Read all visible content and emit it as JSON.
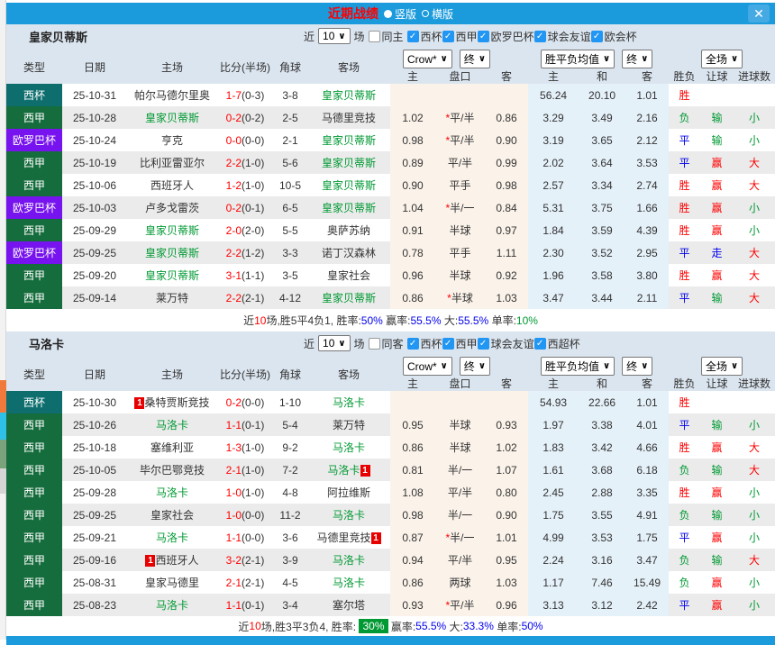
{
  "titlebar": {
    "title": "近期战绩",
    "radio_selected": "竖版",
    "radio_unselected": "横版",
    "close_glyph": "✕"
  },
  "header": {
    "type": "类型",
    "date": "日期",
    "home": "主场",
    "score": "比分(半场)",
    "corner": "角球",
    "away": "客场",
    "crow_select": "Crow*",
    "end_select": "终",
    "crow_subs": [
      "主",
      "盘口",
      "客"
    ],
    "avg_select": "胜平负均值",
    "end_select2": "终",
    "avg_subs": [
      "主",
      "和",
      "客"
    ],
    "result": "胜负",
    "full_select": "全场",
    "handicap": "让球",
    "goals": "进球数",
    "chevron": "∨"
  },
  "colors": {
    "accent_blue": "#1B9BDC",
    "checkbox_blue": "#2196F3",
    "team_green": "#009933",
    "type_colors": {
      "西杯": "#0E6E6E",
      "西甲": "#156C3C",
      "欧罗巴杯": "#7713EE"
    },
    "value_colors": {
      "胜": "#FF0000",
      "平": "#0000EE",
      "负": "#009933",
      "赢": "#FF0000",
      "输": "#009933",
      "走": "#0000EE",
      "大": "#FF0000",
      "小": "#009933"
    },
    "summary_colors": {
      "dark": "#333333",
      "red": "#FF0000",
      "blue": "#0000EE",
      "green": "#009933"
    }
  },
  "sections": [
    {
      "team": "皇家贝蒂斯",
      "filter": {
        "near": "近",
        "count": "10",
        "games": "场",
        "same": "同主",
        "same_checked": false,
        "check_glyph": "✓",
        "comps": [
          "西杯",
          "西甲",
          "欧罗巴杯",
          "球会友谊",
          "欧会杯"
        ]
      },
      "rows": [
        {
          "type": "西杯",
          "date": "25-10-31",
          "home": {
            "name": "帕尔马德尔里奥",
            "green": false
          },
          "score": "1-7",
          "half": "(0-3)",
          "corner": "3-8",
          "away": {
            "name": "皇家贝蒂斯",
            "green": true
          },
          "o1": "",
          "hcap": "",
          "o2": "",
          "a1": "56.24",
          "a2": "20.10",
          "a3": "1.01",
          "res": "胜",
          "wl": "",
          "size": ""
        },
        {
          "type": "西甲",
          "date": "25-10-28",
          "home": {
            "name": "皇家贝蒂斯",
            "green": true
          },
          "score": "0-2",
          "half": "(0-2)",
          "corner": "2-5",
          "away": {
            "name": "马德里竞技",
            "green": false
          },
          "o1": "1.02",
          "hcap": "*平/半",
          "o2": "0.86",
          "a1": "3.29",
          "a2": "3.49",
          "a3": "2.16",
          "res": "负",
          "wl": "输",
          "size": "小"
        },
        {
          "type": "欧罗巴杯",
          "date": "25-10-24",
          "home": {
            "name": "亨克",
            "green": false
          },
          "score": "0-0",
          "half": "(0-0)",
          "corner": "2-1",
          "away": {
            "name": "皇家贝蒂斯",
            "green": true
          },
          "o1": "0.98",
          "hcap": "*平/半",
          "o2": "0.90",
          "a1": "3.19",
          "a2": "3.65",
          "a3": "2.12",
          "res": "平",
          "wl": "输",
          "size": "小"
        },
        {
          "type": "西甲",
          "date": "25-10-19",
          "home": {
            "name": "比利亚雷亚尔",
            "green": false
          },
          "score": "2-2",
          "half": "(1-0)",
          "corner": "5-6",
          "away": {
            "name": "皇家贝蒂斯",
            "green": true
          },
          "o1": "0.89",
          "hcap": "平/半",
          "o2": "0.99",
          "a1": "2.02",
          "a2": "3.64",
          "a3": "3.53",
          "res": "平",
          "wl": "赢",
          "size": "大"
        },
        {
          "type": "西甲",
          "date": "25-10-06",
          "home": {
            "name": "西班牙人",
            "green": false
          },
          "score": "1-2",
          "half": "(1-0)",
          "corner": "10-5",
          "away": {
            "name": "皇家贝蒂斯",
            "green": true
          },
          "o1": "0.90",
          "hcap": "平手",
          "o2": "0.98",
          "a1": "2.57",
          "a2": "3.34",
          "a3": "2.74",
          "res": "胜",
          "wl": "赢",
          "size": "大"
        },
        {
          "type": "欧罗巴杯",
          "date": "25-10-03",
          "home": {
            "name": "卢多戈雷茨",
            "green": false
          },
          "score": "0-2",
          "half": "(0-1)",
          "corner": "6-5",
          "away": {
            "name": "皇家贝蒂斯",
            "green": true
          },
          "o1": "1.04",
          "hcap": "*半/一",
          "o2": "0.84",
          "a1": "5.31",
          "a2": "3.75",
          "a3": "1.66",
          "res": "胜",
          "wl": "赢",
          "size": "小"
        },
        {
          "type": "西甲",
          "date": "25-09-29",
          "home": {
            "name": "皇家贝蒂斯",
            "green": true
          },
          "score": "2-0",
          "half": "(2-0)",
          "corner": "5-5",
          "away": {
            "name": "奥萨苏纳",
            "green": false
          },
          "o1": "0.91",
          "hcap": "半球",
          "o2": "0.97",
          "a1": "1.84",
          "a2": "3.59",
          "a3": "4.39",
          "res": "胜",
          "wl": "赢",
          "size": "小"
        },
        {
          "type": "欧罗巴杯",
          "date": "25-09-25",
          "home": {
            "name": "皇家贝蒂斯",
            "green": true
          },
          "score": "2-2",
          "half": "(1-2)",
          "corner": "3-3",
          "away": {
            "name": "诺丁汉森林",
            "green": false
          },
          "o1": "0.78",
          "hcap": "平手",
          "o2": "1.11",
          "a1": "2.30",
          "a2": "3.52",
          "a3": "2.95",
          "res": "平",
          "wl": "走",
          "size": "大"
        },
        {
          "type": "西甲",
          "date": "25-09-20",
          "home": {
            "name": "皇家贝蒂斯",
            "green": true
          },
          "score": "3-1",
          "half": "(1-1)",
          "corner": "3-5",
          "away": {
            "name": "皇家社会",
            "green": false
          },
          "o1": "0.96",
          "hcap": "半球",
          "o2": "0.92",
          "a1": "1.96",
          "a2": "3.58",
          "a3": "3.80",
          "res": "胜",
          "wl": "赢",
          "size": "大"
        },
        {
          "type": "西甲",
          "date": "25-09-14",
          "home": {
            "name": "莱万特",
            "green": false
          },
          "score": "2-2",
          "half": "(2-1)",
          "corner": "4-12",
          "away": {
            "name": "皇家贝蒂斯",
            "green": true
          },
          "o1": "0.86",
          "hcap": "*半球",
          "o2": "1.03",
          "a1": "3.47",
          "a2": "3.44",
          "a3": "2.11",
          "res": "平",
          "wl": "输",
          "size": "大"
        }
      ],
      "summary": [
        {
          "text": "近",
          "color": "dark"
        },
        {
          "text": "10",
          "color": "red"
        },
        {
          "text": "场,胜5平4负1, 胜率:",
          "color": "dark"
        },
        {
          "text": "50%",
          "color": "blue"
        },
        {
          "text": " 赢率:",
          "color": "dark"
        },
        {
          "text": "55.5%",
          "color": "blue"
        },
        {
          "text": " 大:",
          "color": "dark"
        },
        {
          "text": "55.5%",
          "color": "blue"
        },
        {
          "text": " 单率:",
          "color": "dark"
        },
        {
          "text": "10%",
          "color": "green"
        }
      ]
    },
    {
      "team": "马洛卡",
      "filter": {
        "near": "近",
        "count": "10",
        "games": "场",
        "same": "同客",
        "same_checked": false,
        "check_glyph": "✓",
        "comps": [
          "西杯",
          "西甲",
          "球会友谊",
          "西超杯"
        ]
      },
      "rows": [
        {
          "type": "西杯",
          "date": "25-10-30",
          "home": {
            "name": "桑特贾斯竞技",
            "green": false,
            "badge": "1",
            "badge_pos": "before"
          },
          "score": "0-2",
          "half": "(0-0)",
          "corner": "1-10",
          "away": {
            "name": "马洛卡",
            "green": true
          },
          "o1": "",
          "hcap": "",
          "o2": "",
          "a1": "54.93",
          "a2": "22.66",
          "a3": "1.01",
          "res": "胜",
          "wl": "",
          "size": ""
        },
        {
          "type": "西甲",
          "date": "25-10-26",
          "home": {
            "name": "马洛卡",
            "green": true
          },
          "score": "1-1",
          "half": "(0-1)",
          "corner": "5-4",
          "away": {
            "name": "莱万特",
            "green": false
          },
          "o1": "0.95",
          "hcap": "半球",
          "o2": "0.93",
          "a1": "1.97",
          "a2": "3.38",
          "a3": "4.01",
          "res": "平",
          "wl": "输",
          "size": "小"
        },
        {
          "type": "西甲",
          "date": "25-10-18",
          "home": {
            "name": "塞维利亚",
            "green": false
          },
          "score": "1-3",
          "half": "(1-0)",
          "corner": "9-2",
          "away": {
            "name": "马洛卡",
            "green": true
          },
          "o1": "0.86",
          "hcap": "半球",
          "o2": "1.02",
          "a1": "1.83",
          "a2": "3.42",
          "a3": "4.66",
          "res": "胜",
          "wl": "赢",
          "size": "大"
        },
        {
          "type": "西甲",
          "date": "25-10-05",
          "home": {
            "name": "毕尔巴鄂竞技",
            "green": false
          },
          "score": "2-1",
          "half": "(1-0)",
          "corner": "7-2",
          "away": {
            "name": "马洛卡",
            "green": true,
            "badge": "1",
            "badge_pos": "after"
          },
          "o1": "0.81",
          "hcap": "半/一",
          "o2": "1.07",
          "a1": "1.61",
          "a2": "3.68",
          "a3": "6.18",
          "res": "负",
          "wl": "输",
          "size": "大"
        },
        {
          "type": "西甲",
          "date": "25-09-28",
          "home": {
            "name": "马洛卡",
            "green": true
          },
          "score": "1-0",
          "half": "(1-0)",
          "corner": "4-8",
          "away": {
            "name": "阿拉维斯",
            "green": false
          },
          "o1": "1.08",
          "hcap": "平/半",
          "o2": "0.80",
          "a1": "2.45",
          "a2": "2.88",
          "a3": "3.35",
          "res": "胜",
          "wl": "赢",
          "size": "小"
        },
        {
          "type": "西甲",
          "date": "25-09-25",
          "home": {
            "name": "皇家社会",
            "green": false
          },
          "score": "1-0",
          "half": "(0-0)",
          "corner": "11-2",
          "away": {
            "name": "马洛卡",
            "green": true
          },
          "o1": "0.98",
          "hcap": "半/一",
          "o2": "0.90",
          "a1": "1.75",
          "a2": "3.55",
          "a3": "4.91",
          "res": "负",
          "wl": "输",
          "size": "小"
        },
        {
          "type": "西甲",
          "date": "25-09-21",
          "home": {
            "name": "马洛卡",
            "green": true
          },
          "score": "1-1",
          "half": "(0-0)",
          "corner": "3-6",
          "away": {
            "name": "马德里竞技",
            "green": false,
            "badge": "1",
            "badge_pos": "after"
          },
          "o1": "0.87",
          "hcap": "*半/一",
          "o2": "1.01",
          "a1": "4.99",
          "a2": "3.53",
          "a3": "1.75",
          "res": "平",
          "wl": "赢",
          "size": "小"
        },
        {
          "type": "西甲",
          "date": "25-09-16",
          "home": {
            "name": "西班牙人",
            "green": false,
            "badge": "1",
            "badge_pos": "before"
          },
          "score": "3-2",
          "half": "(2-1)",
          "corner": "3-9",
          "away": {
            "name": "马洛卡",
            "green": true
          },
          "o1": "0.94",
          "hcap": "平/半",
          "o2": "0.95",
          "a1": "2.24",
          "a2": "3.16",
          "a3": "3.47",
          "res": "负",
          "wl": "输",
          "size": "大"
        },
        {
          "type": "西甲",
          "date": "25-08-31",
          "home": {
            "name": "皇家马德里",
            "green": false
          },
          "score": "2-1",
          "half": "(2-1)",
          "corner": "4-5",
          "away": {
            "name": "马洛卡",
            "green": true
          },
          "o1": "0.86",
          "hcap": "两球",
          "o2": "1.03",
          "a1": "1.17",
          "a2": "7.46",
          "a3": "15.49",
          "res": "负",
          "wl": "赢",
          "size": "小"
        },
        {
          "type": "西甲",
          "date": "25-08-23",
          "home": {
            "name": "马洛卡",
            "green": true
          },
          "score": "1-1",
          "half": "(0-1)",
          "corner": "3-4",
          "away": {
            "name": "塞尔塔",
            "green": false
          },
          "o1": "0.93",
          "hcap": "*平/半",
          "o2": "0.96",
          "a1": "3.13",
          "a2": "3.12",
          "a3": "2.42",
          "res": "平",
          "wl": "赢",
          "size": "小"
        }
      ],
      "summary": [
        {
          "text": "近",
          "color": "dark"
        },
        {
          "text": "10",
          "color": "red"
        },
        {
          "text": "场,胜3平3负4, 胜率: ",
          "color": "dark"
        },
        {
          "text": "30%",
          "color": "badge"
        },
        {
          "text": " 赢率:",
          "color": "dark"
        },
        {
          "text": "55.5%",
          "color": "blue"
        },
        {
          "text": " 大:",
          "color": "dark"
        },
        {
          "text": "33.3%",
          "color": "blue"
        },
        {
          "text": " 单率:",
          "color": "dark"
        },
        {
          "text": "50%",
          "color": "blue"
        }
      ]
    }
  ]
}
